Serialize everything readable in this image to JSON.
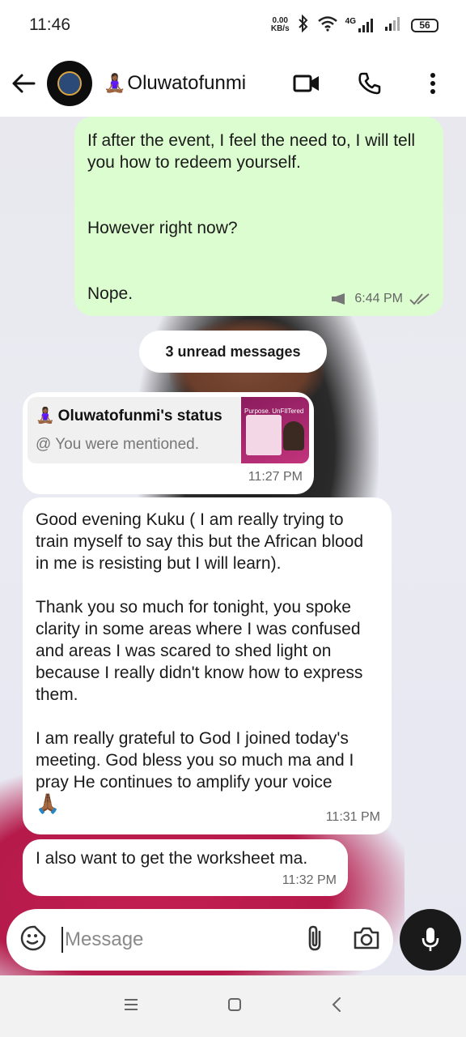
{
  "status_bar": {
    "time": "11:46",
    "speed_value": "0.00",
    "speed_unit": "KB/s",
    "network": "4G",
    "battery": "56"
  },
  "header": {
    "contact_emoji": "🧘🏾‍♀️",
    "contact_name": "Oluwatofunmi"
  },
  "messages": {
    "m1": {
      "lines": [
        "If after the event, I feel the need to, I will tell you how to redeem yourself.",
        "",
        "However right now?",
        "",
        "Nope."
      ],
      "time": "6:44 PM"
    },
    "unread_label": "3 unread messages",
    "status_reply": {
      "emoji": "🧘🏾‍♀️",
      "title": "Oluwatofunmi's status",
      "subtitle": "@ You were mentioned.",
      "thumb_text": "Purpose. UnFIlTered",
      "time": "11:27 PM"
    },
    "m3": {
      "p1": "Good evening Kuku ( I am really trying to train myself to say this but the African blood in me is resisting but I will learn).",
      "p2": "Thank you so much for tonight, you spoke clarity in some areas where I was confused and areas I was scared to shed light on because I really didn't know how to express them.",
      "p3": "I am really grateful to God I joined today's meeting. God bless you so much ma and I pray He continues to amplify your voice",
      "p3_emoji": "🙏🏾",
      "time": "11:31 PM"
    },
    "m4": {
      "text": "I also want to get the worksheet ma.",
      "time": "11:32 PM"
    }
  },
  "composer": {
    "placeholder": "Message"
  },
  "colors": {
    "outgoing_bubble": "#dcfdd0",
    "incoming_bubble": "#ffffff",
    "mic_button": "#1a1a1a"
  }
}
